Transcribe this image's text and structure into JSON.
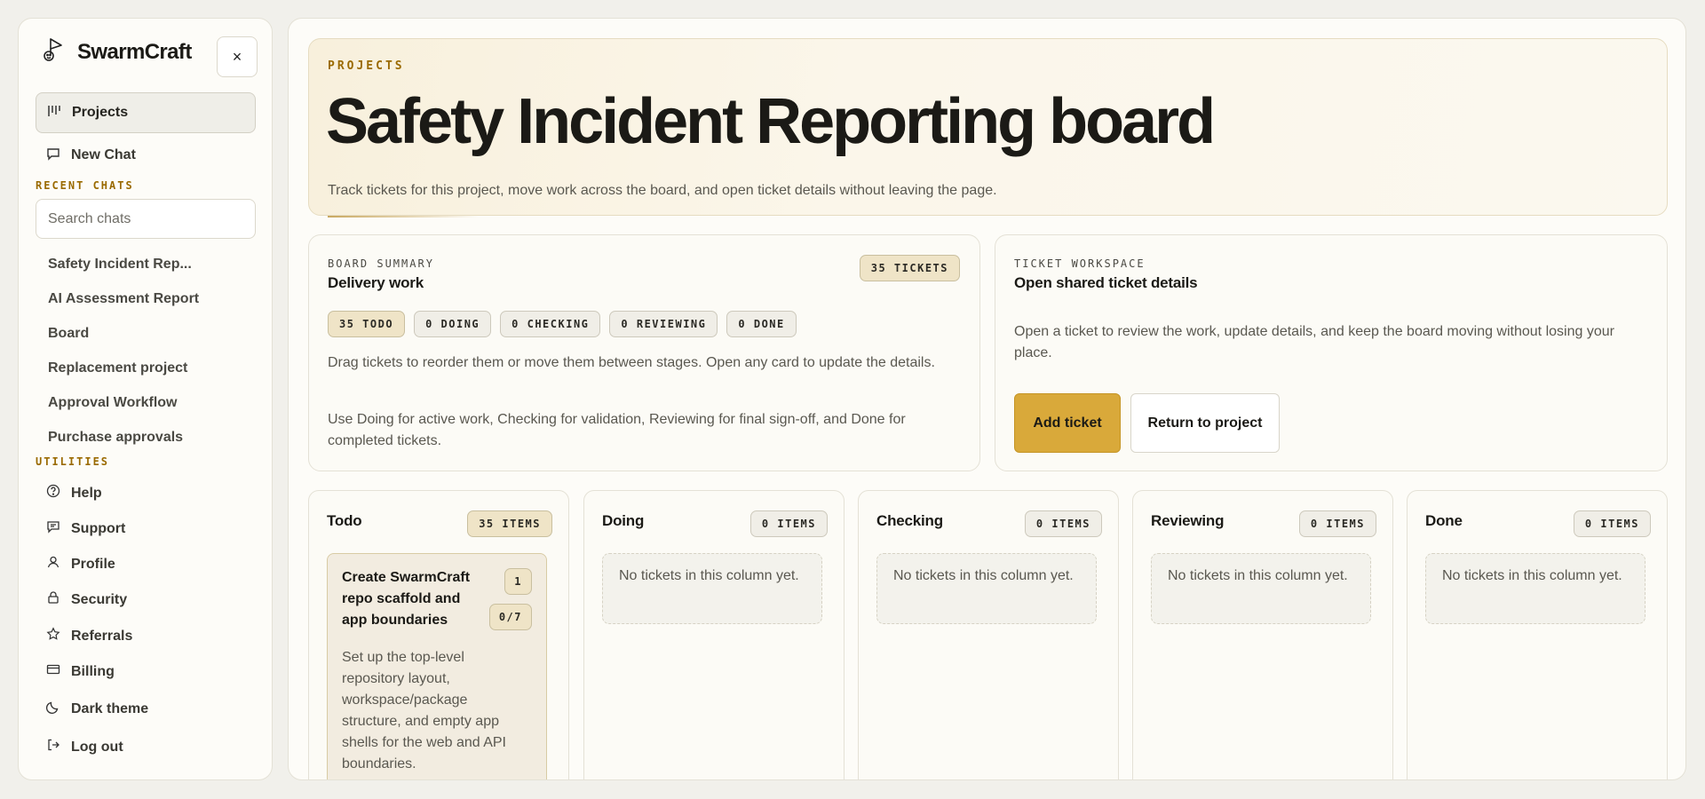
{
  "sidebar": {
    "brand": "SwarmCraft",
    "close_label": "×",
    "nav": [
      {
        "label": "Projects",
        "icon": "kanban-icon",
        "active": true
      },
      {
        "label": "New Chat",
        "icon": "chat-bubble-icon",
        "active": false
      }
    ],
    "recent_label": "RECENT CHATS",
    "search_placeholder": "Search chats",
    "chats": [
      "Safety Incident Rep...",
      "AI Assessment Report",
      "Board",
      "Replacement project",
      "Approval Workflow",
      "Purchase approvals"
    ],
    "utilities_label": "UTILITIES",
    "utilities": [
      {
        "label": "Help",
        "icon": "help-circle-icon"
      },
      {
        "label": "Support",
        "icon": "support-chat-icon"
      },
      {
        "label": "Profile",
        "icon": "user-icon"
      },
      {
        "label": "Security",
        "icon": "lock-icon"
      },
      {
        "label": "Referrals",
        "icon": "star-icon"
      },
      {
        "label": "Billing",
        "icon": "credit-card-icon"
      },
      {
        "label": "Dark theme",
        "icon": "moon-icon"
      },
      {
        "label": "Log out",
        "icon": "logout-icon"
      }
    ]
  },
  "hero": {
    "eyebrow": "PROJECTS",
    "title": "Safety Incident Reporting board",
    "description": "Track tickets for this project, move work across the board, and open ticket details without leaving the page."
  },
  "summary": {
    "kicker": "BOARD SUMMARY",
    "title": "Delivery work",
    "ticket_count": "35 TICKETS",
    "stage_counts": [
      "35 TODO",
      "0 DOING",
      "0 CHECKING",
      "0 REVIEWING",
      "0 DONE"
    ],
    "paragraph1": "Drag tickets to reorder them or move them between stages. Open any card to update the details.",
    "paragraph2": "Use Doing for active work, Checking for validation, Reviewing for final sign-off, and Done for completed tickets."
  },
  "workspace": {
    "kicker": "TICKET WORKSPACE",
    "title": "Open shared ticket details",
    "paragraph": "Open a ticket to review the work, update details, and keep the board moving without losing your place.",
    "add_label": "Add ticket",
    "return_label": "Return to project"
  },
  "columns": [
    {
      "title": "Todo",
      "count": "35 ITEMS"
    },
    {
      "title": "Doing",
      "count": "0 ITEMS",
      "empty": "No tickets in this column yet."
    },
    {
      "title": "Checking",
      "count": "0 ITEMS",
      "empty": "No tickets in this column yet."
    },
    {
      "title": "Reviewing",
      "count": "0 ITEMS",
      "empty": "No tickets in this column yet."
    },
    {
      "title": "Done",
      "count": "0 ITEMS",
      "empty": "No tickets in this column yet."
    }
  ],
  "first_ticket": {
    "title": "Create SwarmCraft repo scaffold and app boundaries",
    "id": "1",
    "progress": "0/7",
    "description": "Set up the top-level repository layout, workspace/package structure, and empty app shells for the web and API boundaries."
  },
  "colors": {
    "accent": "#d9a93a",
    "eyebrow": "#9a6a00",
    "badge_fill": "#efe4c7"
  }
}
